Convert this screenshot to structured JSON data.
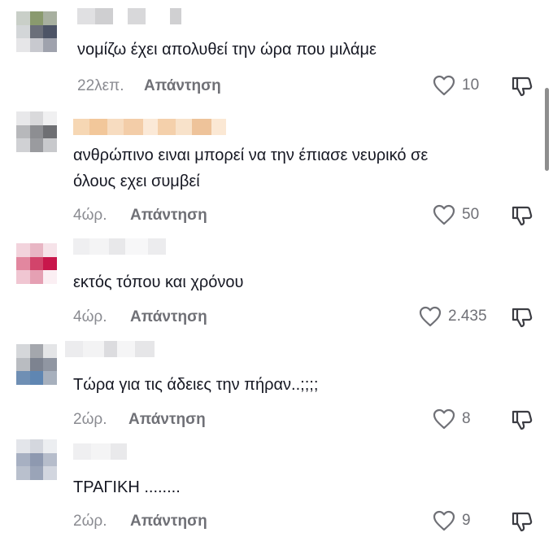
{
  "comments": [
    {
      "text_lines": [
        "νομίζω έχει απολυθεί την ώρα που μιλάμε"
      ],
      "time": "22λεπ.",
      "reply_label": "Απάντηση",
      "likes": "10"
    },
    {
      "text_lines": [
        "ανθρώπινο ειναι μπορεί να την έπιασε νευρικό σε",
        "όλους εχει συμβεί"
      ],
      "time": "4ώρ.",
      "reply_label": "Απάντηση",
      "likes": "50"
    },
    {
      "text_lines": [
        "εκτός τόπου και χρόνου"
      ],
      "time": "4ώρ.",
      "reply_label": "Απάντηση",
      "likes": "2.435"
    },
    {
      "text_lines": [
        "Τώρα για τις άδειες την πήραν..;;;;"
      ],
      "time": "2ώρ.",
      "reply_label": "Απάντηση",
      "likes": "8"
    },
    {
      "text_lines": [
        "ΤΡΑΓΙΚΗ ........"
      ],
      "time": "2ώρ.",
      "reply_label": "Απάντηση",
      "likes": "9"
    }
  ],
  "icons": {
    "like": "heart-outline-icon",
    "dislike": "thumbs-down-outline-icon"
  },
  "colors": {
    "text": "#161823",
    "meta": "#8a8b91",
    "reply": "#6f7076"
  }
}
